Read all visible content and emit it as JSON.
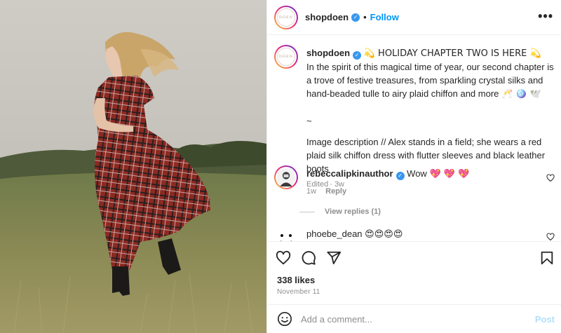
{
  "post": {
    "author": "shopdoen",
    "avatar_text": "DŌEN",
    "follow_label": "Follow",
    "separator": "•",
    "more_glyph": "•••"
  },
  "caption": {
    "username": "shopdoen",
    "headline": "💫 HOLIDAY CHAPTER TWO IS HERE 💫",
    "paragraph": "In the spirit of this magical time of year, our second chapter is a trove of festive treasures, from sparkling crystal silks and hand-beaded tulle to airy plaid chiffon and more",
    "paragraph_emoji": "🥂 🪩 🕊️",
    "tilde": "~",
    "image_description": "Image description // Alex stands in a field; she wears a red plaid silk chiffon dress with flutter sleeves and black leather boots",
    "edited": "Edited",
    "time": "3w"
  },
  "comments": [
    {
      "username": "rebeccalipkinauthor",
      "verified": true,
      "text": "Wow",
      "emoji": "💖 💖 💖",
      "time": "1w",
      "reply_label": "Reply",
      "view_replies": "View replies (1)"
    },
    {
      "username": "phoebe_dean",
      "verified": false,
      "text": "",
      "emoji": "😍😍😍😍"
    }
  ],
  "actions": {
    "likes": "338 likes",
    "date": "November 11"
  },
  "composer": {
    "placeholder": "Add a comment...",
    "post_label": "Post"
  },
  "colors": {
    "accent_blue": "#0095f6",
    "post_disabled": "#b2dffc",
    "verified_blue": "#3897f0",
    "muted_text": "#8e8e8e"
  },
  "icons": [
    "heart-icon",
    "comment-icon",
    "share-icon",
    "bookmark-icon",
    "emoji-icon",
    "more-icon",
    "verified-icon"
  ]
}
